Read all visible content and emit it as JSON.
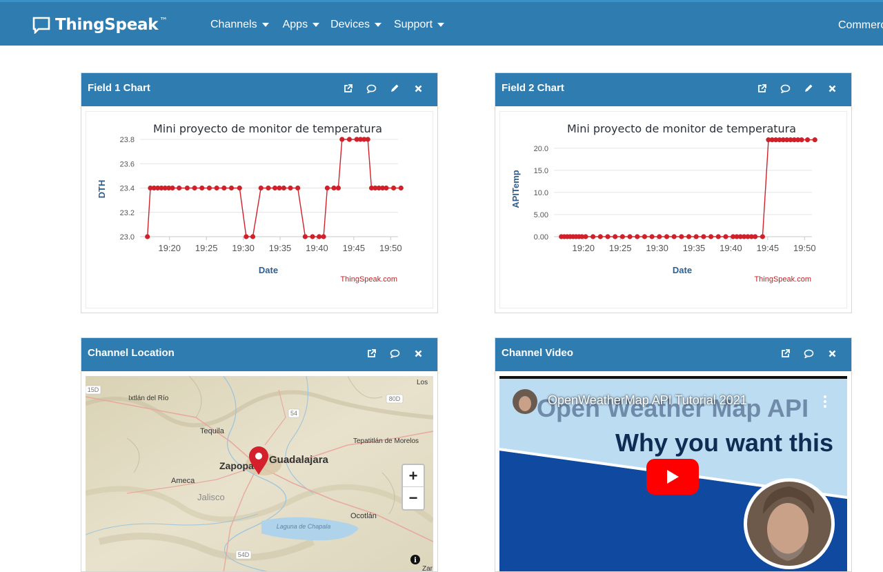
{
  "header": {
    "brand": "ThingSpeak",
    "tm": "™",
    "nav": [
      "Channels",
      "Apps",
      "Devices",
      "Support"
    ],
    "right_link": "Commercial Use"
  },
  "panels": {
    "field1": {
      "title": "Field 1 Chart",
      "icons": [
        "external-link-icon",
        "comment-icon",
        "pencil-icon",
        "close-icon"
      ]
    },
    "field2": {
      "title": "Field 2 Chart",
      "icons": [
        "external-link-icon",
        "comment-icon",
        "pencil-icon",
        "close-icon"
      ]
    },
    "location": {
      "title": "Channel Location",
      "icons": [
        "external-link-icon",
        "comment-icon",
        "close-icon"
      ]
    },
    "video": {
      "title": "Channel Video",
      "icons": [
        "external-link-icon",
        "comment-icon",
        "close-icon"
      ]
    }
  },
  "chart_data": [
    {
      "type": "line",
      "title": "Mini proyecto de monitor de temperatura",
      "xlabel": "Date",
      "ylabel": "DTH",
      "credit": "ThingSpeak.com",
      "ylim": [
        23.0,
        23.8
      ],
      "yticks": [
        "23.0",
        "23.2",
        "23.4",
        "23.6",
        "23.8"
      ],
      "xticks": [
        "19:20",
        "19:25",
        "19:30",
        "19:35",
        "19:40",
        "19:45",
        "19:50"
      ],
      "xlim_minutes": [
        1156,
        1191
      ],
      "color": "#d0202a",
      "points": [
        [
          1157.0,
          23.0
        ],
        [
          1157.4,
          23.4
        ],
        [
          1157.9,
          23.4
        ],
        [
          1158.4,
          23.4
        ],
        [
          1158.9,
          23.4
        ],
        [
          1159.4,
          23.4
        ],
        [
          1159.9,
          23.4
        ],
        [
          1160.4,
          23.4
        ],
        [
          1161.3,
          23.4
        ],
        [
          1162.4,
          23.4
        ],
        [
          1163.4,
          23.4
        ],
        [
          1164.4,
          23.4
        ],
        [
          1165.4,
          23.4
        ],
        [
          1166.4,
          23.4
        ],
        [
          1167.4,
          23.4
        ],
        [
          1168.4,
          23.4
        ],
        [
          1169.5,
          23.4
        ],
        [
          1170.4,
          23.0
        ],
        [
          1171.3,
          23.0
        ],
        [
          1172.4,
          23.4
        ],
        [
          1173.4,
          23.4
        ],
        [
          1174.3,
          23.4
        ],
        [
          1174.9,
          23.4
        ],
        [
          1175.5,
          23.4
        ],
        [
          1176.4,
          23.4
        ],
        [
          1177.4,
          23.4
        ],
        [
          1178.4,
          23.0
        ],
        [
          1179.4,
          23.0
        ],
        [
          1180.3,
          23.0
        ],
        [
          1180.9,
          23.0
        ],
        [
          1181.4,
          23.4
        ],
        [
          1182.3,
          23.4
        ],
        [
          1182.9,
          23.4
        ],
        [
          1183.4,
          23.8
        ],
        [
          1184.4,
          23.8
        ],
        [
          1185.4,
          23.8
        ],
        [
          1185.9,
          23.8
        ],
        [
          1186.4,
          23.8
        ],
        [
          1186.9,
          23.8
        ],
        [
          1187.4,
          23.4
        ],
        [
          1187.9,
          23.4
        ],
        [
          1188.4,
          23.4
        ],
        [
          1188.9,
          23.4
        ],
        [
          1189.4,
          23.4
        ],
        [
          1190.4,
          23.4
        ],
        [
          1191.4,
          23.4
        ]
      ]
    },
    {
      "type": "line",
      "title": "Mini proyecto de monitor de temperatura",
      "xlabel": "Date",
      "ylabel": "APITemp",
      "credit": "ThingSpeak.com",
      "ylim": [
        0,
        22
      ],
      "yticks": [
        "0.00",
        "5.00",
        "10.0",
        "15.0",
        "20.0"
      ],
      "yvals": [
        0,
        5,
        10,
        15,
        20
      ],
      "xticks": [
        "19:20",
        "19:25",
        "19:30",
        "19:35",
        "19:40",
        "19:45",
        "19:50"
      ],
      "xlim_minutes": [
        1156,
        1191
      ],
      "color": "#d0202a",
      "points": [
        [
          1157.0,
          0
        ],
        [
          1157.4,
          0
        ],
        [
          1157.8,
          0
        ],
        [
          1158.2,
          0
        ],
        [
          1158.6,
          0
        ],
        [
          1159.0,
          0
        ],
        [
          1159.4,
          0
        ],
        [
          1159.8,
          0
        ],
        [
          1160.3,
          0
        ],
        [
          1161.3,
          0
        ],
        [
          1162.3,
          0
        ],
        [
          1163.3,
          0
        ],
        [
          1164.3,
          0
        ],
        [
          1165.3,
          0
        ],
        [
          1166.3,
          0
        ],
        [
          1167.3,
          0
        ],
        [
          1168.3,
          0
        ],
        [
          1169.3,
          0
        ],
        [
          1170.3,
          0
        ],
        [
          1171.3,
          0
        ],
        [
          1172.3,
          0
        ],
        [
          1173.3,
          0
        ],
        [
          1174.3,
          0
        ],
        [
          1175.3,
          0
        ],
        [
          1176.3,
          0
        ],
        [
          1177.3,
          0
        ],
        [
          1178.3,
          0
        ],
        [
          1179.3,
          0
        ],
        [
          1180.3,
          0
        ],
        [
          1180.8,
          0
        ],
        [
          1181.3,
          0
        ],
        [
          1181.8,
          0
        ],
        [
          1182.3,
          0
        ],
        [
          1182.8,
          0
        ],
        [
          1183.3,
          0
        ],
        [
          1184.3,
          0
        ],
        [
          1185.1,
          21.9
        ],
        [
          1185.6,
          21.9
        ],
        [
          1186.1,
          21.9
        ],
        [
          1186.6,
          21.9
        ],
        [
          1187.1,
          21.9
        ],
        [
          1187.6,
          21.9
        ],
        [
          1188.1,
          21.9
        ],
        [
          1188.6,
          21.9
        ],
        [
          1189.1,
          21.9
        ],
        [
          1189.6,
          21.9
        ],
        [
          1190.4,
          21.9
        ],
        [
          1191.4,
          21.9
        ]
      ]
    }
  ],
  "map": {
    "labels": [
      "Ixtlán del Río",
      "Tequila",
      "Tepatitlán de Morelos",
      "Zapopan",
      "Guadalajara",
      "Ameca",
      "Jalisco",
      "Ocotlán",
      "Laguna de Chapala",
      "Los",
      "Zar"
    ],
    "road_labels": [
      "15D",
      "80D",
      "54",
      "54D"
    ],
    "zoom_in": "+",
    "zoom_out": "−"
  },
  "video": {
    "title": "OpenWeatherMap API Tutorial 2021",
    "overlay": "Open Weather Map API",
    "subtitle": "Why you want this"
  }
}
